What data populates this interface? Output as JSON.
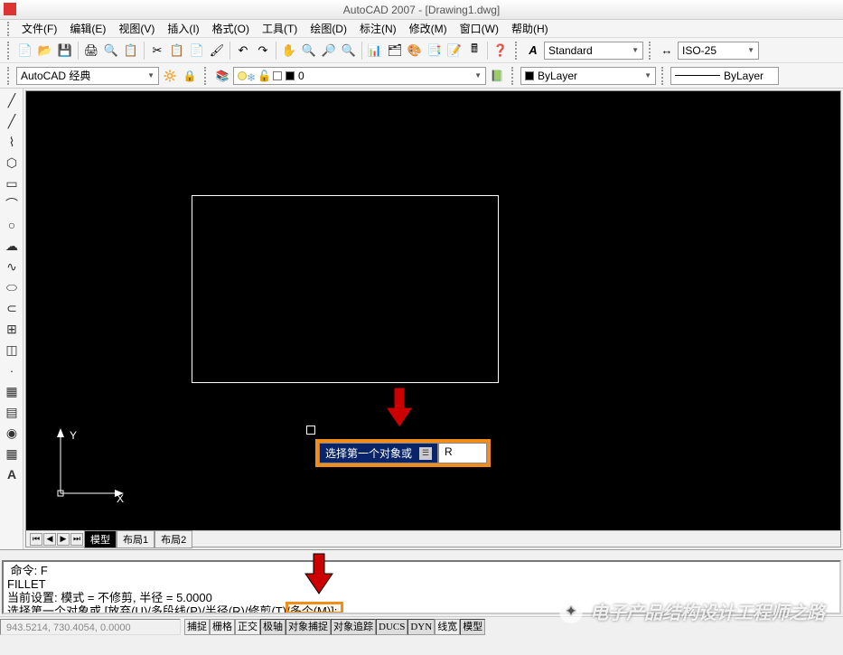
{
  "title": "AutoCAD 2007 - [Drawing1.dwg]",
  "menu": [
    "文件(F)",
    "编辑(E)",
    "视图(V)",
    "插入(I)",
    "格式(O)",
    "工具(T)",
    "绘图(D)",
    "标注(N)",
    "修改(M)",
    "窗口(W)",
    "帮助(H)"
  ],
  "workspace_combo": "AutoCAD 经典",
  "style_combo": "Standard",
  "dim_combo": "ISO-25",
  "layer_combo": "0",
  "bylayer_combo": "ByLayer",
  "linetype_combo": "ByLayer",
  "dyn_prompt": "选择第一个对象或",
  "dyn_value": "R",
  "layout_tabs": {
    "active": "模型",
    "t1": "布局1",
    "t2": "布局2"
  },
  "ucs": {
    "x": "X",
    "y": "Y"
  },
  "cmd_lines": {
    "l1": " 命令: F",
    "l2": "FILLET",
    "l3": "当前设置: 模式 = 不修剪, 半径 = 5.0000",
    "l4": "选择第一个对象或 [放弃(U)/多段线(P)/半径(R)/修剪(T)/多个(M)]:"
  },
  "status": {
    "coord": "943.5214, 730.4054, 0.0000",
    "buttons": [
      "捕捉",
      "栅格",
      "正交",
      "极轴",
      "对象捕捉",
      "对象追踪",
      "DUCS",
      "DYN",
      "线宽",
      "模型"
    ]
  },
  "watermark": "电子产品结构设计工程师之路",
  "colors": {
    "accent_orange": "#f28c1a",
    "arrow_red": "#cc0000",
    "prompt_bg": "#0a246a"
  }
}
